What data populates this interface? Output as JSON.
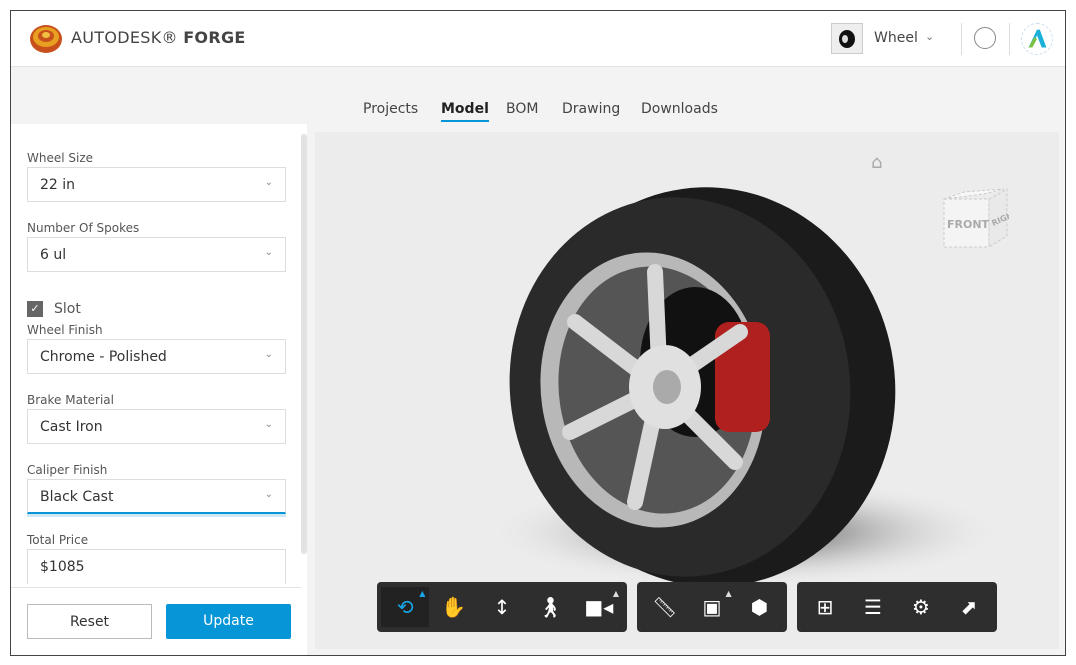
{
  "header": {
    "brand_light": "AUTODESK®",
    "brand_bold": "FORGE",
    "product": "Wheel"
  },
  "tabs": [
    "Projects",
    "Model",
    "BOM",
    "Drawing",
    "Downloads"
  ],
  "active_tab": "Model",
  "form": {
    "wheel_size": {
      "label": "Wheel Size",
      "value": "22 in"
    },
    "spokes": {
      "label": "Number Of Spokes",
      "value": "6 ul"
    },
    "slot": {
      "label": "Slot",
      "checked": true
    },
    "wheel_finish": {
      "label": "Wheel Finish",
      "value": "Chrome - Polished"
    },
    "brake_material": {
      "label": "Brake Material",
      "value": "Cast Iron"
    },
    "caliper_finish": {
      "label": "Caliper Finish",
      "value": "Black Cast"
    },
    "total_price": {
      "label": "Total Price",
      "value": "$1085"
    }
  },
  "buttons": {
    "reset": "Reset",
    "update": "Update"
  },
  "viewcube": {
    "front": "FRONT",
    "right": "RIGHT"
  },
  "toolbar": {
    "groups": [
      [
        "orbit",
        "pan",
        "dolly",
        "first-person",
        "camera"
      ],
      [
        "measure",
        "section",
        "explode"
      ],
      [
        "model-browser",
        "properties",
        "settings",
        "fullscreen"
      ]
    ],
    "active": "orbit"
  },
  "colors": {
    "accent": "#0696d7",
    "toolbar": "#2e2e2e"
  }
}
